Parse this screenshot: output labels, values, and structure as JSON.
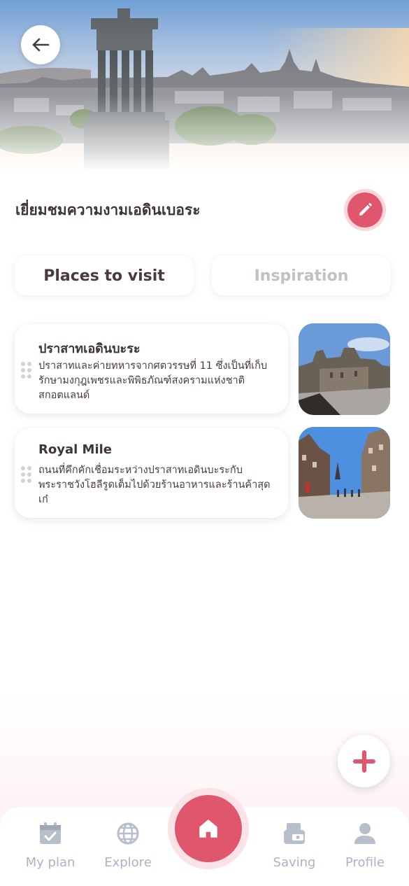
{
  "header": {
    "title": "เยี่ยมชมความงามเอดินเบอระ"
  },
  "icons": {
    "back": "arrow-left-icon",
    "edit": "pencil-icon",
    "add": "plus-icon",
    "drag": "drag-handle-icon"
  },
  "tabs": [
    {
      "label": "Places to visit",
      "active": true
    },
    {
      "label": "Inspiration",
      "active": false
    }
  ],
  "places": [
    {
      "name": "ปราสาทเอดินบะระ",
      "description": "ปราสาทและค่ายทหารจากศตวรรษที่ 11 ซึ่งเป็นที่เก็บรักษามงกุฎเพชรและพิพิธภัณฑ์สงครามแห่งชาติสกอตแลนด์"
    },
    {
      "name": "Royal Mile",
      "description": "ถนนที่คึกคักเชื่อมระหว่างปราสาทเอดินบะระกับพระราชวังโฮลีรูดเต็มไปด้วยร้านอาหารและร้านค้าสุดเก๋"
    }
  ],
  "nav": {
    "items": [
      {
        "label": "My plan",
        "icon": "calendar-check-icon"
      },
      {
        "label": "Explore",
        "icon": "globe-icon"
      },
      {
        "label": "",
        "icon": "home-icon"
      },
      {
        "label": "Saving",
        "icon": "piggy-bank-icon"
      },
      {
        "label": "Profile",
        "icon": "user-icon"
      }
    ]
  },
  "colors": {
    "accent": "#e0566d",
    "accent_light": "#fbd6dc",
    "nav_inactive": "#a9b4c9",
    "text": "#4a3a3c"
  }
}
